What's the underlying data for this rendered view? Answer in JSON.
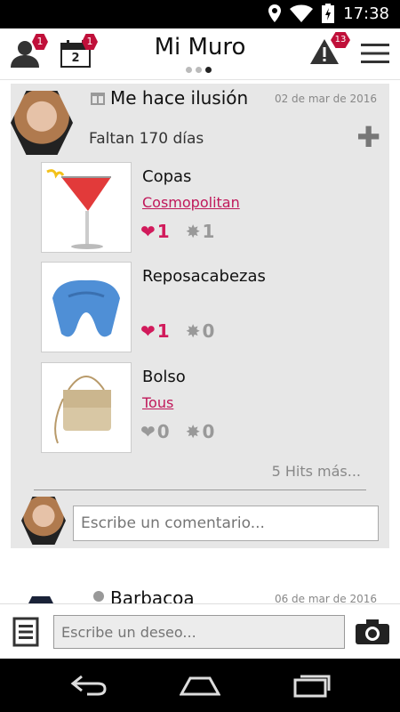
{
  "status": {
    "time": "17:38"
  },
  "header": {
    "title": "Mi Muro",
    "profile_badge": "1",
    "calendar_badge": "1",
    "calendar_day": "2",
    "alerts_badge": "13"
  },
  "post": {
    "title": "Me hace ilusión",
    "date": "02 de mar de 2016",
    "countdown": "Faltan 170 días",
    "items": [
      {
        "name": "Copas",
        "brand": "Cosmopolitan",
        "likes": "1",
        "stars": "1",
        "liked": true
      },
      {
        "name": "Reposacabezas",
        "brand": "",
        "likes": "1",
        "stars": "0",
        "liked": true
      },
      {
        "name": "Bolso",
        "brand": "Tous",
        "likes": "0",
        "stars": "0",
        "liked": false
      }
    ],
    "more": "5 Hits más...",
    "comment_placeholder": "Escribe un comentario..."
  },
  "next_post": {
    "title": "Barbacoa",
    "date": "06 de mar de 2016"
  },
  "bottom": {
    "wish_placeholder": "Escribe un deseo..."
  },
  "colors": {
    "accent": "#c0185a",
    "like": "#d11a5b",
    "badge": "#c0103a"
  }
}
